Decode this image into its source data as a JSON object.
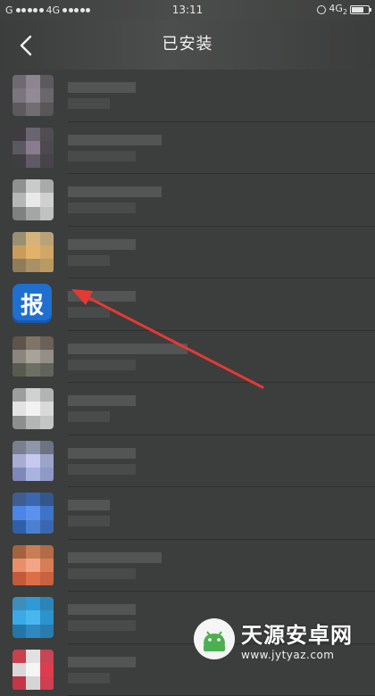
{
  "status_bar": {
    "carrier": "G",
    "network_left": "4G",
    "time": "13:11",
    "network_right": "4G",
    "network_right_sub": "2",
    "battery_level": 0.7
  },
  "header": {
    "title": "已安装",
    "back_icon": "chevron-left-icon"
  },
  "apps": [
    {
      "icon_colors": [
        "#6f6a72",
        "#8d8591",
        "#5d595f",
        "#7b767e",
        "#938a96",
        "#6a666b",
        "#5c5a5d",
        "#716d73",
        "#585659"
      ],
      "text_rows": [
        2,
        1
      ]
    },
    {
      "icon_colors": [
        "#3e3c41",
        "#6a6470",
        "#4f4c52",
        "#5a5860",
        "#8a7b8f",
        "#4c4a4f",
        "#3f3e42",
        "#5f5a63",
        "#464449"
      ],
      "text_rows": [
        3,
        2
      ]
    },
    {
      "icon_colors": [
        "#8f9190",
        "#c9cbca",
        "#a9abaa",
        "#b5b7b6",
        "#e8e9e8",
        "#cfd0cf",
        "#7f8180",
        "#a4a6a5",
        "#c0c2c1"
      ],
      "text_rows": [
        3,
        2
      ]
    },
    {
      "icon_colors": [
        "#9a8f73",
        "#d6b37b",
        "#b9a27a",
        "#c79c5d",
        "#e3b26a",
        "#cfa766",
        "#8e7d58",
        "#a89167",
        "#b89a62"
      ],
      "text_rows": [
        2,
        1
      ]
    },
    {
      "pinned": true,
      "label": "报",
      "text_rows": [
        2,
        1
      ]
    },
    {
      "icon_colors": [
        "#5f544a",
        "#7f7468",
        "#6a6158",
        "#8a857e",
        "#a7a39b",
        "#938e86",
        "#5a5b4f",
        "#6e6f63",
        "#62635a"
      ],
      "text_rows": [
        4,
        2
      ]
    },
    {
      "icon_colors": [
        "#9c9e9d",
        "#d0d2d1",
        "#b2b4b3",
        "#e2e3e2",
        "#f2f2f2",
        "#d8d9d8",
        "#8d8f8e",
        "#b4b6b5",
        "#c4c6c5"
      ],
      "text_rows": [
        2,
        1
      ]
    },
    {
      "icon_colors": [
        "#7a7f90",
        "#8f95ab",
        "#6e7384",
        "#a7acd0",
        "#c6c8ee",
        "#9ca4c8",
        "#7f88b8",
        "#aab3e0",
        "#8f98c6"
      ],
      "text_rows": [
        2,
        2
      ]
    },
    {
      "icon_colors": [
        "#3f5d8e",
        "#3b66b0",
        "#35568a",
        "#4b86e6",
        "#5a92ee",
        "#3d74c8",
        "#2f5fa8",
        "#4c7fd0",
        "#3a67b0"
      ],
      "text_rows": [
        1,
        1
      ]
    },
    {
      "icon_colors": [
        "#a4623f",
        "#c97d55",
        "#b36a46",
        "#e98e6a",
        "#f1a585",
        "#d77d57",
        "#c35a3a",
        "#dc6e4a",
        "#c9623f"
      ],
      "text_rows": [
        3,
        2
      ]
    },
    {
      "icon_colors": [
        "#3c8fbd",
        "#2f9ad6",
        "#2b85b8",
        "#3aa9e6",
        "#4ab6ee",
        "#2c93cc",
        "#2476a8",
        "#2f88c0",
        "#2a7cb0"
      ],
      "text_rows": [
        2,
        2
      ]
    },
    {
      "icon_colors": [
        "#c9404f",
        "#e1e1e1",
        "#c94455",
        "#d8d8d8",
        "#f5f5f5",
        "#e03c50",
        "#c23648",
        "#d5d5d5",
        "#cf3f4f"
      ],
      "text_rows": [
        2,
        1
      ]
    }
  ],
  "watermark": {
    "name": "天源安卓网",
    "url": "www.jytyaz.com",
    "logo_icon": "android-robot-icon"
  },
  "colors": {
    "background": "#3b3e3c",
    "accent_arrow": "#e53935",
    "pinned_app": "#1f6fd1"
  }
}
